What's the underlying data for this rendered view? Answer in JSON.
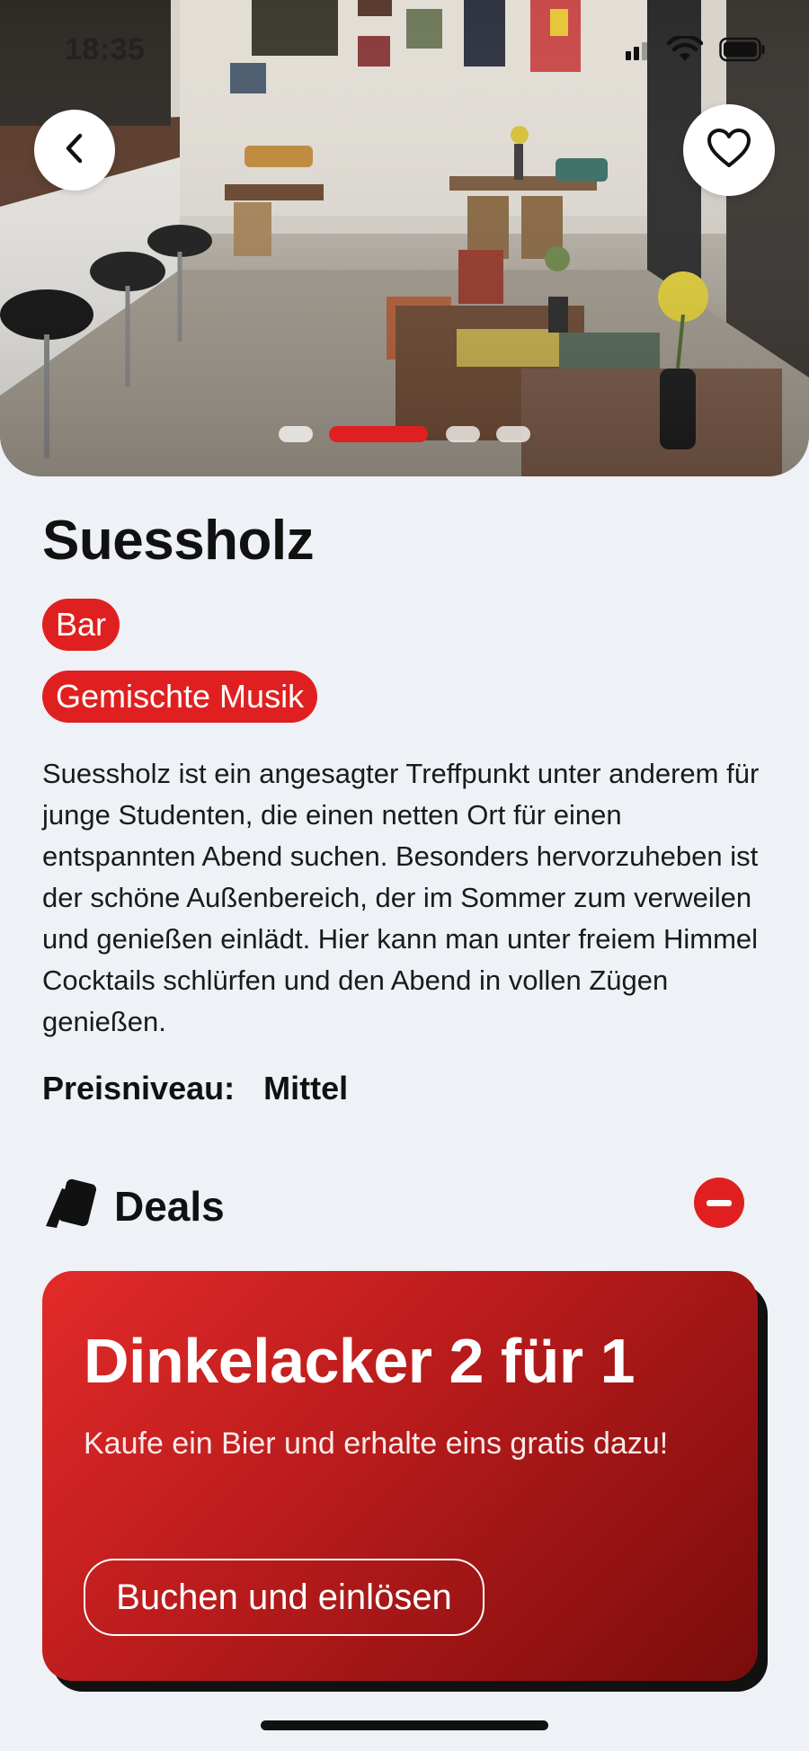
{
  "status_bar": {
    "time": "18:35"
  },
  "hero": {
    "back_icon": "chevron-left-icon",
    "favorite_icon": "heart-outline-icon",
    "carousel": {
      "total": 4,
      "active_index": 1
    }
  },
  "venue": {
    "name": "Suessholz",
    "tags": [
      "Bar",
      "Gemischte Musik"
    ],
    "description": "Suessholz ist ein angesagter Treffpunkt unter anderem für junge Studenten, die einen netten Ort für einen entspannten Abend suchen. Besonders hervorzuheben ist der schöne Außenbereich, der im Sommer zum verweilen und genießen einlädt. Hier kann man unter freiem Himmel Cocktails schlürfen und den Abend in vollen Zügen genießen.",
    "price_label": "Preisniveau:",
    "price_value": "Mittel"
  },
  "deals": {
    "title": "Deals",
    "icon": "cards-icon",
    "collapse_icon": "minus-circle-icon",
    "items": [
      {
        "title": "Dinkelacker 2 für 1",
        "description": "Kaufe ein Bier und erhalte eins gratis dazu!",
        "button_label": "Buchen und einlösen"
      }
    ]
  },
  "colors": {
    "accent": "#e02020",
    "background": "#eef1f5",
    "text": "#111111"
  }
}
